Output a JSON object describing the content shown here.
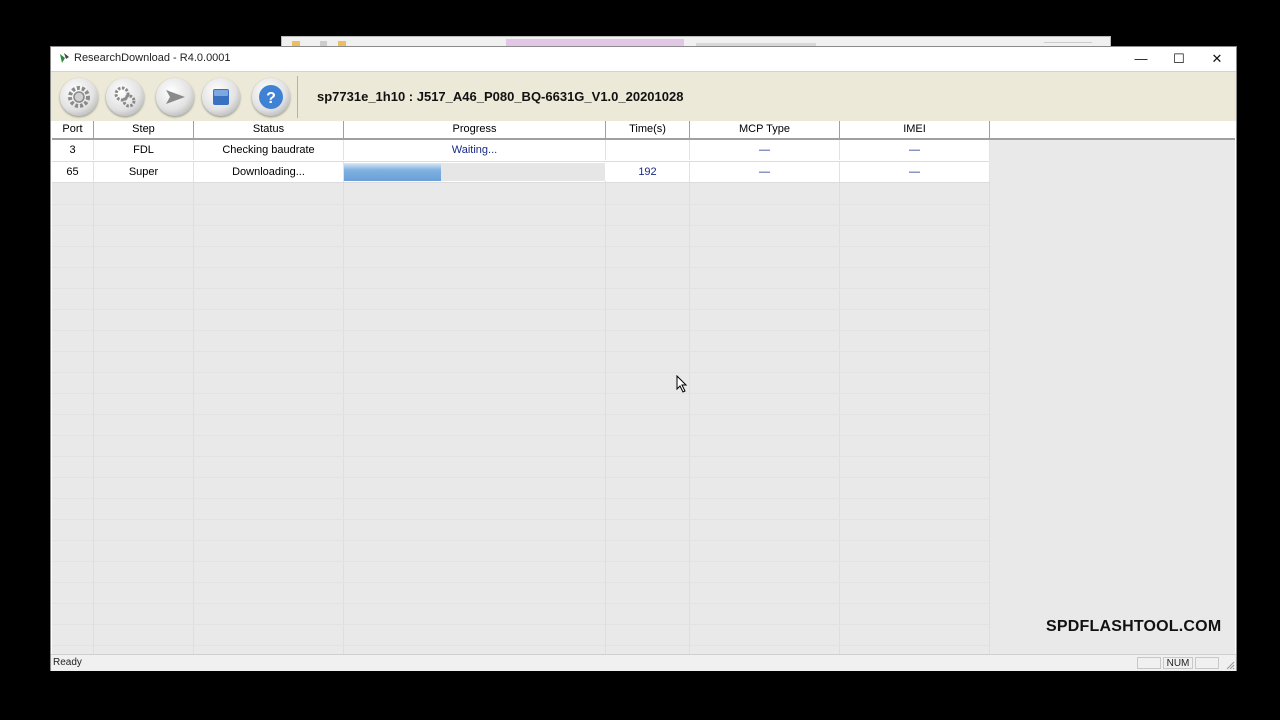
{
  "window": {
    "title": "ResearchDownload - R4.0.0001",
    "controls": {
      "minimize": "—",
      "maximize": "☐",
      "close": "✕"
    }
  },
  "toolbar": {
    "buttons": [
      {
        "name": "settings-gear-icon"
      },
      {
        "name": "settings-gears-icon"
      },
      {
        "name": "start-download-icon"
      },
      {
        "name": "stop-icon"
      },
      {
        "name": "help-icon"
      }
    ],
    "packet_name": "sp7731e_1h10 : J517_A46_P080_BQ-6631G_V1.0_20201028"
  },
  "table": {
    "columns": [
      "Port",
      "Step",
      "Status",
      "Progress",
      "Time(s)",
      "MCP Type",
      "IMEI"
    ],
    "rows": [
      {
        "port": "3",
        "step": "FDL",
        "status": "Checking baudrate",
        "progress_text": "Waiting...",
        "progress_fraction": 0,
        "time": "",
        "mcp_type": "—",
        "imei": "—"
      },
      {
        "port": "65",
        "step": "Super",
        "status": "Downloading...",
        "progress_text": "",
        "progress_fraction": 0.37,
        "time": "192",
        "mcp_type": "—",
        "imei": "—"
      }
    ]
  },
  "watermark": "SPDFLASHTOOL.COM",
  "statusbar": {
    "status": "Ready",
    "num": "NUM"
  },
  "colors": {
    "toolbar_bg": "#ece9d8",
    "progress_fill": "#7fb0e0",
    "blue_text": "#1a2a8a"
  }
}
